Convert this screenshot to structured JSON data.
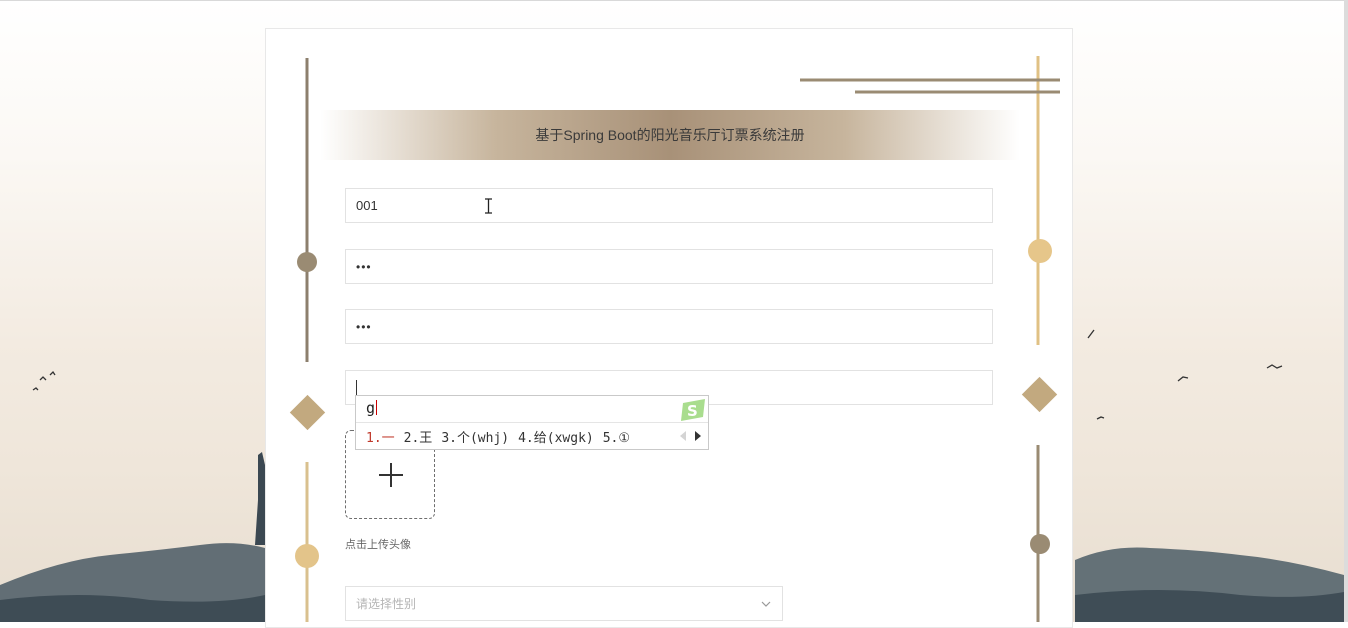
{
  "page": {
    "title": "基于Spring Boot的阳光音乐厅订票系统注册"
  },
  "form": {
    "username_value": "001",
    "password_value": "•••",
    "confirm_password_value": "•••",
    "upload_hint": "点击上传头像",
    "gender_placeholder": "请选择性别"
  },
  "ime": {
    "composition": "g",
    "candidates": [
      "1.一",
      "2.王",
      "3.个(whj)",
      "4.给(xwgk)",
      "5.①"
    ]
  },
  "colors": {
    "accent": "#b49a76",
    "gold": "#e6c68a",
    "dark_line": "#8c7f6d"
  }
}
